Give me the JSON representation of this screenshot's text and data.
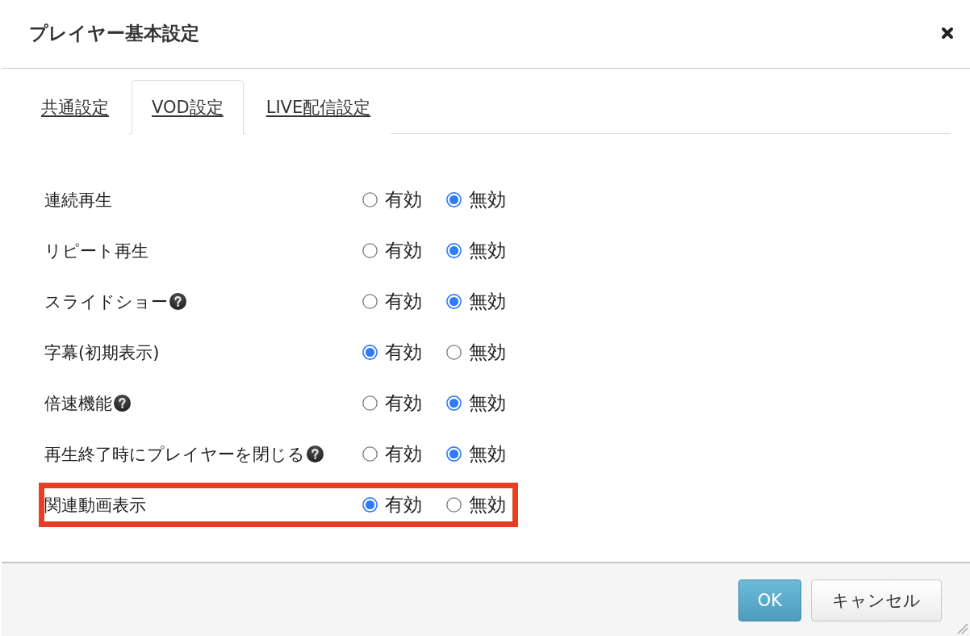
{
  "dialog": {
    "title": "プレイヤー基本設定"
  },
  "tabs": [
    {
      "label": "共通設定",
      "selected": false
    },
    {
      "label": "VOD設定",
      "selected": true
    },
    {
      "label": "LIVE配信設定",
      "selected": false
    }
  ],
  "settings": [
    {
      "label": "連続再生",
      "help": false,
      "highlighted": false,
      "options": [
        {
          "label": "有効",
          "selected": false
        },
        {
          "label": "無効",
          "selected": true
        }
      ]
    },
    {
      "label": "リピート再生",
      "help": false,
      "highlighted": false,
      "options": [
        {
          "label": "有効",
          "selected": false
        },
        {
          "label": "無効",
          "selected": true
        }
      ]
    },
    {
      "label": "スライドショー",
      "help": true,
      "highlighted": false,
      "options": [
        {
          "label": "有効",
          "selected": false
        },
        {
          "label": "無効",
          "selected": true
        }
      ]
    },
    {
      "label": "字幕(初期表示)",
      "help": false,
      "highlighted": false,
      "options": [
        {
          "label": "有効",
          "selected": true
        },
        {
          "label": "無効",
          "selected": false
        }
      ]
    },
    {
      "label": "倍速機能",
      "help": true,
      "highlighted": false,
      "options": [
        {
          "label": "有効",
          "selected": false
        },
        {
          "label": "無効",
          "selected": true
        }
      ]
    },
    {
      "label": "再生終了時にプレイヤーを閉じる",
      "help": true,
      "highlighted": false,
      "options": [
        {
          "label": "有効",
          "selected": false
        },
        {
          "label": "無効",
          "selected": true
        }
      ]
    },
    {
      "label": "関連動画表示",
      "help": false,
      "highlighted": true,
      "options": [
        {
          "label": "有効",
          "selected": true
        },
        {
          "label": "無効",
          "selected": false
        }
      ]
    }
  ],
  "buttons": [
    {
      "label": "OK",
      "kind": "primary"
    },
    {
      "label": "キャンセル",
      "kind": "secondary"
    }
  ]
}
